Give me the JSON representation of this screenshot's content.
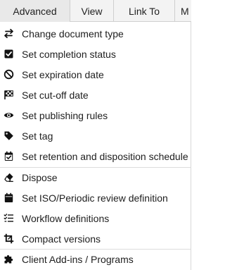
{
  "tabs": [
    {
      "label": "Advanced"
    },
    {
      "label": "View"
    },
    {
      "label": "Link To"
    },
    {
      "label": "M"
    }
  ],
  "menu": {
    "groups": [
      [
        {
          "label": "Change document type",
          "icon": "swap-arrows-icon"
        },
        {
          "label": "Set completion status",
          "icon": "checkbox-checked-icon"
        },
        {
          "label": "Set expiration date",
          "icon": "prohibited-icon"
        },
        {
          "label": "Set cut-off date",
          "icon": "checkered-flag-icon"
        },
        {
          "label": "Set publishing rules",
          "icon": "eye-icon"
        },
        {
          "label": "Set tag",
          "icon": "tag-icon"
        },
        {
          "label": "Set retention and disposition schedule",
          "icon": "calendar-check-icon"
        }
      ],
      [
        {
          "label": "Dispose",
          "icon": "eraser-icon"
        },
        {
          "label": "Set ISO/Periodic review definition",
          "icon": "calendar-icon"
        },
        {
          "label": "Workflow definitions",
          "icon": "checklist-icon"
        },
        {
          "label": "Compact versions",
          "icon": "crop-icon"
        }
      ],
      [
        {
          "label": "Client Add-ins / Programs",
          "icon": "puzzle-icon"
        }
      ]
    ]
  }
}
